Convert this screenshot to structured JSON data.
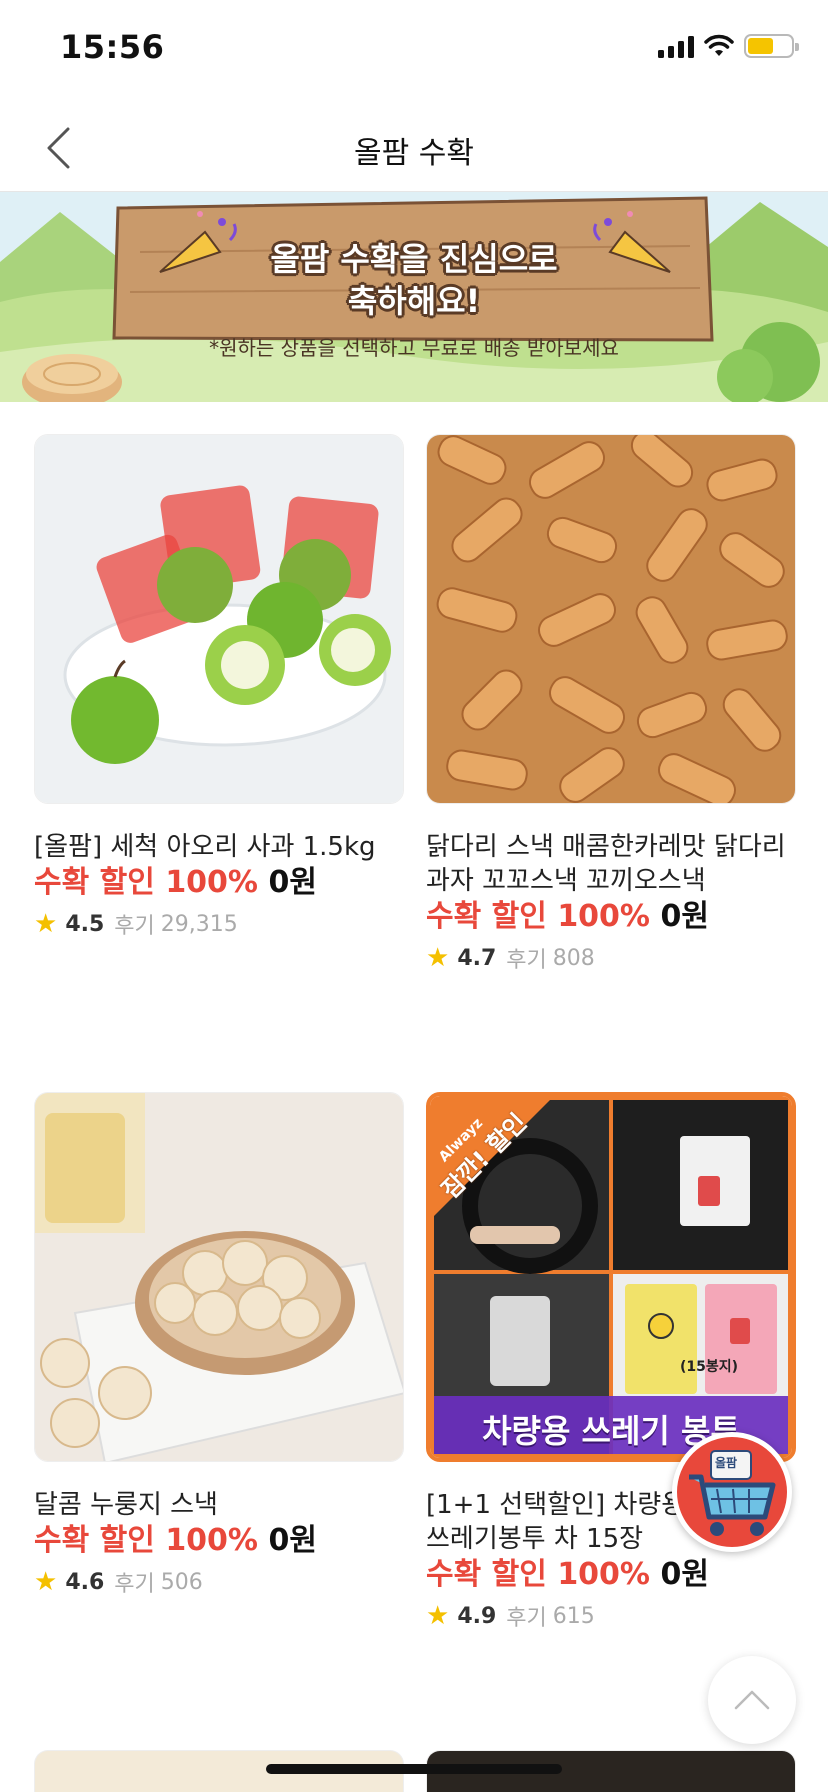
{
  "status_bar": {
    "time": "15:56"
  },
  "nav": {
    "title": "올팜 수확"
  },
  "banner": {
    "title_line1": "올팜 수확을 진심으로",
    "title_line2": "축하해요!",
    "subtitle": "*원하는 상품을 선택하고 무료로 배송 받아보세요"
  },
  "products": [
    {
      "name": "[올팜] 세척 아오리 사과 1.5kg",
      "price_label": "수확 할인",
      "discount": "100%",
      "price": "0원",
      "rating": "4.5",
      "review_label": "후기",
      "review_count": "29,315",
      "image": "green-apples-photo"
    },
    {
      "name": "닭다리 스낵 매콤한카레맛 닭다리과자 꼬꼬스낵 꼬끼오스낵",
      "price_label": "수확 할인",
      "discount": "100%",
      "price": "0원",
      "rating": "4.7",
      "review_label": "후기",
      "review_count": "808",
      "image": "drumstick-snack-photo"
    },
    {
      "name": "달콤 누룽지 스낵",
      "price_label": "수확 할인",
      "discount": "100%",
      "price": "0원",
      "rating": "4.6",
      "review_label": "후기",
      "review_count": "506",
      "image": "rice-crisp-snack-photo"
    },
    {
      "name": "[1+1 선택할인] 차량용 자동차 쓰레기봉투 차 15장",
      "price_label": "수확 할인",
      "discount": "100%",
      "price": "0원",
      "rating": "4.9",
      "review_label": "후기",
      "review_count": "615",
      "image": "car-trash-bag-photo",
      "image_texts": {
        "brand": "Alwayz",
        "badge": "잠깐! 할인",
        "caption": "차량용 쓰레기 봉투",
        "pack": "(15봉지)"
      }
    }
  ],
  "cart_fab": {
    "label": "올팜",
    "icon": "cart-icon"
  },
  "scroll_top": {
    "icon": "chevron-up-icon"
  },
  "colors": {
    "accent": "#e8483b",
    "star": "#f4c000",
    "banner_wood": "#c99a6b"
  }
}
